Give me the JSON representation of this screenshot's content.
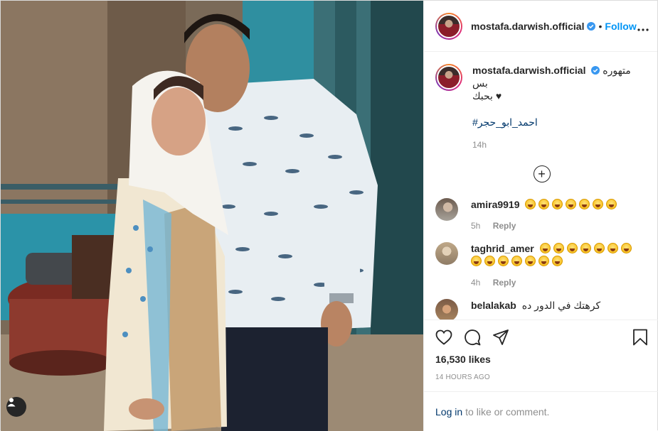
{
  "post": {
    "username": "mostafa.darwish.official",
    "follow_label": "Follow",
    "separator": "•"
  },
  "caption": {
    "username": "mostafa.darwish.official",
    "text_line1": "متهوره بس",
    "text_line2": "بحبك ♥",
    "hashtag": "#احمد_ابو_حجر",
    "time": "14h"
  },
  "comments": [
    {
      "username": "amira9919",
      "emoji_count": 7,
      "time": "5h",
      "reply_label": "Reply"
    },
    {
      "username": "taghrid_amer",
      "emoji_count": 7,
      "emoji_count_line2": 7,
      "time": "4h",
      "reply_label": "Reply"
    },
    {
      "username": "belalakab",
      "text": "كرهتك في الدور ده"
    }
  ],
  "actions": {
    "likes": "16,530 likes",
    "posted_time": "14 HOURS AGO",
    "login_link": "Log in",
    "login_suffix": "to like or comment."
  },
  "icons": [
    "user-tag-icon",
    "verified-badge-icon",
    "more-options-icon",
    "load-more-comments-icon",
    "heart-icon",
    "comment-icon",
    "share-icon",
    "bookmark-icon"
  ],
  "colors": {
    "link_blue": "#0095f6",
    "hashtag_blue": "#00376b",
    "muted_gray": "#8e8e8e",
    "border": "#efefef"
  }
}
